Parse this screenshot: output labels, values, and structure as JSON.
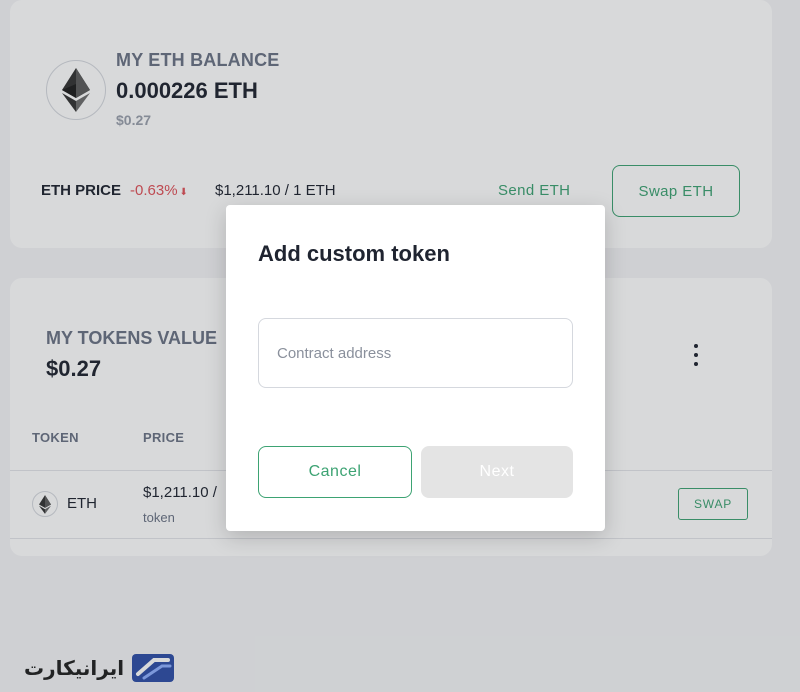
{
  "balance": {
    "label": "MY ETH BALANCE",
    "value": "0.000226 ETH",
    "usd": "$0.27",
    "price_label": "ETH PRICE",
    "price_change": "-0.63%",
    "price_rate": "$1,211.10 / 1 ETH",
    "send_label": "Send ETH",
    "swap_label": "Swap ETH"
  },
  "tokens": {
    "label": "MY TOKENS VALUE",
    "value": "$0.27",
    "columns": [
      "TOKEN",
      "PRICE"
    ],
    "rows": [
      {
        "name": "ETH",
        "price": "$1,211.10 /",
        "unit": "token",
        "action": "SWAP"
      }
    ]
  },
  "modal": {
    "title": "Add custom token",
    "input_placeholder": "Contract address",
    "input_value": "",
    "cancel_label": "Cancel",
    "next_label": "Next"
  },
  "watermark": {
    "text": "ایرانیکارت"
  },
  "colors": {
    "accent": "#3da373",
    "negative": "#e0525a",
    "text": "#1f2430",
    "muted": "#6b7385",
    "disabled_button": "#e4e4e4"
  },
  "icons": {
    "eth": "ethereum-icon",
    "kebab": "more-vertical-icon",
    "down_arrow": "arrow-down-icon",
    "logo": "iranicard-logo-icon"
  }
}
